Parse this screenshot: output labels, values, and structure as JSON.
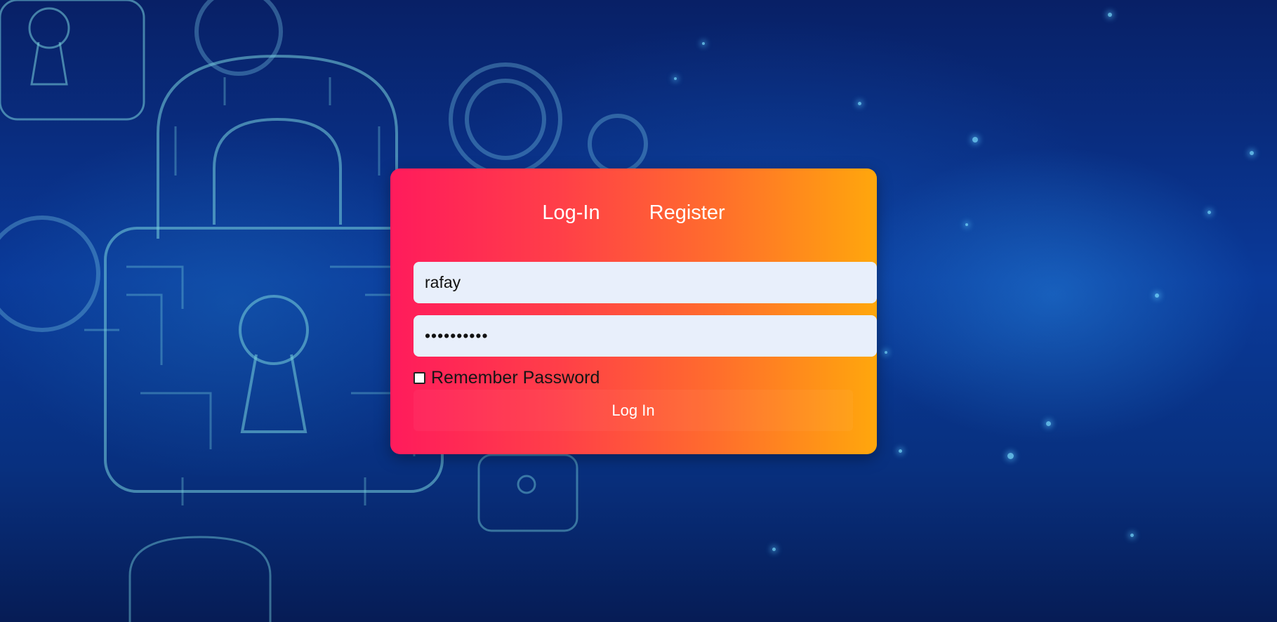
{
  "tabs": {
    "login": "Log-In",
    "register": "Register"
  },
  "form": {
    "username_value": "rafay",
    "password_value": "••••••••••",
    "remember_label": "Remember Password",
    "remember_checked": false,
    "submit_label": "Log In"
  },
  "theme": {
    "card_gradient": [
      "#ff1b5c",
      "#ffa70c"
    ],
    "input_bg": "#e8effb",
    "background": "#0a3a9a"
  },
  "background_icons": [
    "padlock-icon",
    "circuit-pattern"
  ]
}
